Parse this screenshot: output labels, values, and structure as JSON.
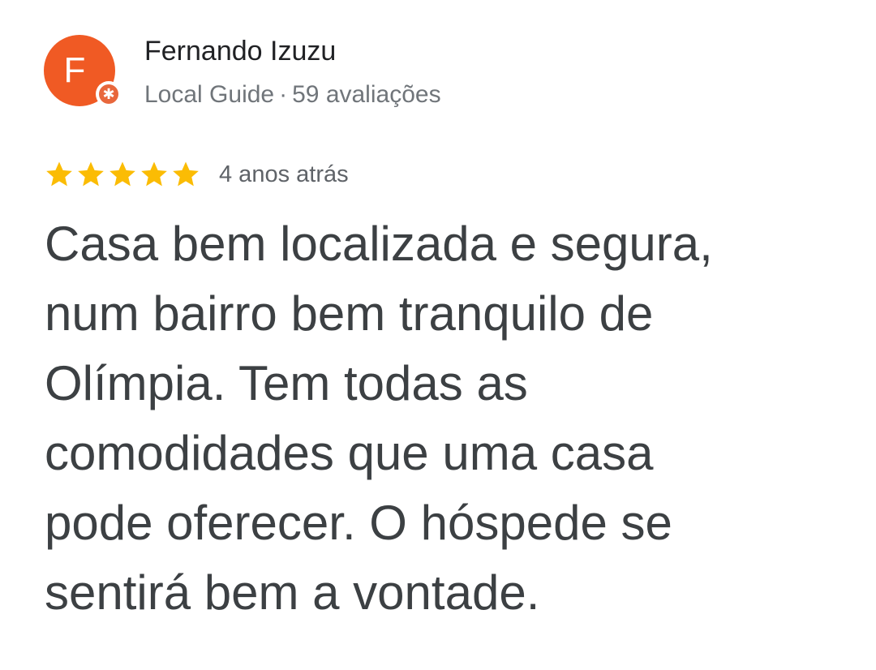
{
  "author": {
    "initial": "F",
    "name": "Fernando Izuzu",
    "guide_label": "Local Guide",
    "separator": "·",
    "reviews_count": "59 avaliações",
    "avatar_color": "#f05a24",
    "badge_icon": "local-guide-star-icon"
  },
  "review": {
    "rating": 5,
    "max_rating": 5,
    "star_color": "#fbbc04",
    "date": "4 anos atrás",
    "text": "Casa bem localizada e segura,\nnum bairro bem tranquilo de\nOlímpia. Tem todas as\ncomodidades que uma casa\npode oferecer. O hóspede se\nsentirá bem a vontade."
  }
}
